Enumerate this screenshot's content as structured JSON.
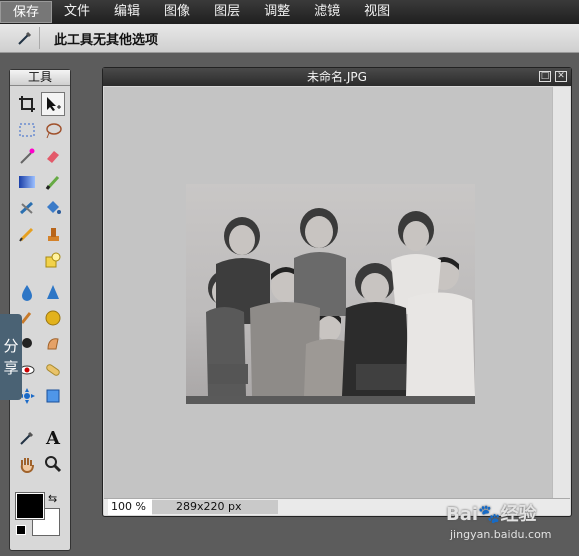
{
  "menubar": {
    "items": [
      {
        "label": "保存"
      },
      {
        "label": "文件"
      },
      {
        "label": "编辑"
      },
      {
        "label": "图像"
      },
      {
        "label": "图层"
      },
      {
        "label": "调整"
      },
      {
        "label": "滤镜"
      },
      {
        "label": "视图"
      }
    ]
  },
  "options_bar": {
    "active_tool_icon": "eyedropper-icon",
    "label": "此工具无其他选项"
  },
  "tools_panel": {
    "title": "工具",
    "tools": [
      {
        "icon": "crop-icon"
      },
      {
        "icon": "move-icon"
      },
      {
        "icon": "marquee-icon"
      },
      {
        "icon": "lasso-icon"
      },
      {
        "icon": "magic-wand-icon"
      },
      {
        "icon": "eraser-icon"
      },
      {
        "icon": "gradient-icon"
      },
      {
        "icon": "brush-icon"
      },
      {
        "icon": "clone-stamp-icon"
      },
      {
        "icon": "paint-bucket-icon"
      },
      {
        "icon": "pencil-icon"
      },
      {
        "icon": "stamp-icon"
      },
      {
        "icon": "shape-icon"
      },
      {
        "icon": "blur-icon"
      },
      {
        "icon": "sharpen-icon"
      },
      {
        "icon": "dodge-icon"
      },
      {
        "icon": "sponge-icon"
      },
      {
        "icon": "zoom-lens-icon"
      },
      {
        "icon": "smudge-icon"
      },
      {
        "icon": "red-eye-icon"
      },
      {
        "icon": "bandage-icon"
      },
      {
        "icon": "transform-icon"
      },
      {
        "icon": "selection-transform-icon"
      },
      {
        "icon": "eyedropper-icon"
      },
      {
        "icon": "text-icon"
      },
      {
        "icon": "hand-icon"
      },
      {
        "icon": "zoom-icon"
      }
    ],
    "foreground_color": "#000000",
    "background_color": "#ffffff"
  },
  "share_tab": {
    "label_1": "分",
    "label_2": "享"
  },
  "document": {
    "title": "未命名.JPG",
    "zoom": "100",
    "zoom_unit": "%",
    "dimensions": "289x220 px"
  },
  "watermark": {
    "brand": "Bai",
    "brand2": "经验",
    "url": "jingyan.baidu.com"
  },
  "colors": {
    "accent": "#4a6274",
    "canvas_bg": "#c4c4c4",
    "menubar": "#2a2a2a"
  }
}
